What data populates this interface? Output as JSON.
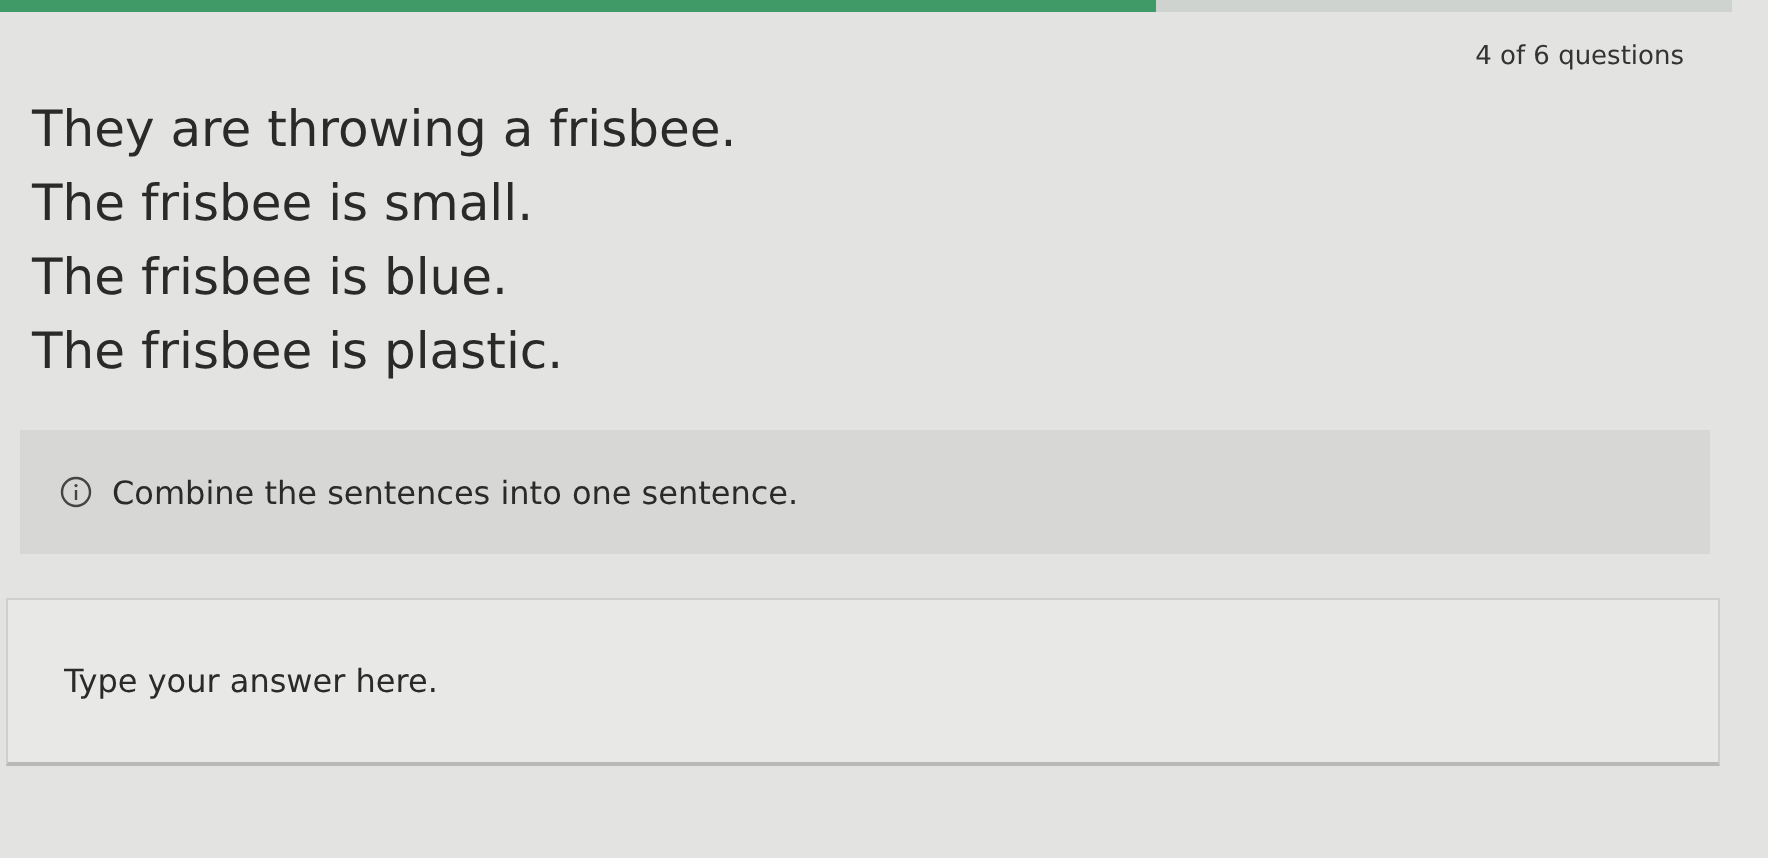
{
  "progress": {
    "level": 0.667
  },
  "counter": "4 of 6 questions",
  "sentences": [
    "They are throwing a frisbee.",
    "The frisbee is small.",
    "The frisbee is blue.",
    "The frisbee is plastic."
  ],
  "instruction": "Combine the sentences into one sentence.",
  "answer": {
    "placeholder": "Type your answer here."
  }
}
